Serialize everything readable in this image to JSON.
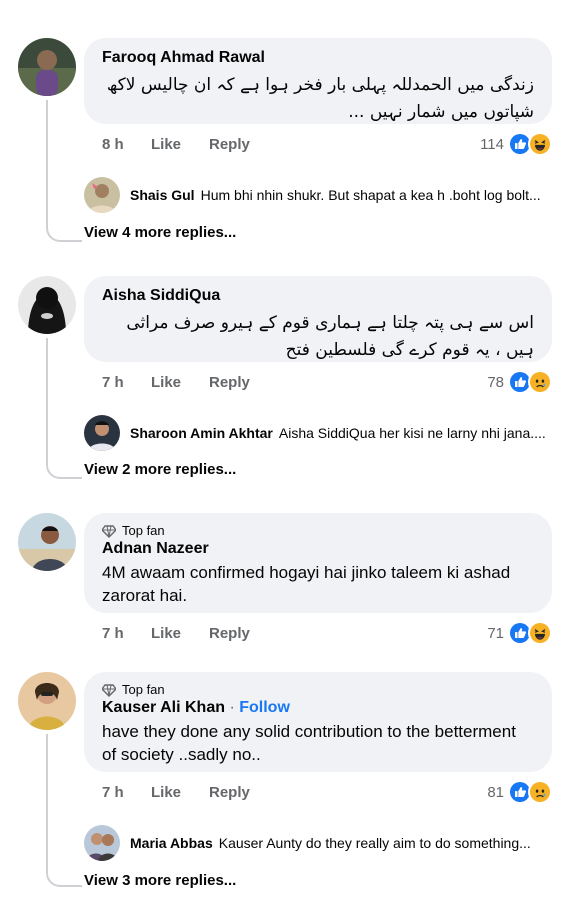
{
  "comments": [
    {
      "author": "Farooq Ahmad Rawal",
      "text": "زندگی میں الحمدللہ پہلی بار فخر ہوا ہے کہ ان چالیس لاکھ شپاتوں میں شمار نہیں ...",
      "time": "8 h",
      "like": "Like",
      "reply": "Reply",
      "reaction_count": "114",
      "reactions": [
        "like-reaction",
        "haha-reaction"
      ],
      "top_reply": {
        "author": "Shais Gul",
        "text": "Hum bhi nhin shukr. But shapat a kea h .boht log bolt..."
      },
      "more_replies": "View 4 more replies..."
    },
    {
      "author": "Aisha SiddiQua",
      "text": "اس سے ہی پتہ چلتا ہے ہماری قوم کے ہیرو صرف  مراثی ہیں ، یہ قوم کرے گی فلسطین فتح",
      "time": "7 h",
      "like": "Like",
      "reply": "Reply",
      "reaction_count": "78",
      "reactions": [
        "like-reaction",
        "sad-reaction"
      ],
      "top_reply": {
        "author": "Sharoon Amin Akhtar",
        "text": "Aisha SiddiQua her kisi ne larny nhi jana...."
      },
      "more_replies": "View 2 more replies..."
    },
    {
      "badge": "Top fan",
      "author": "Adnan Nazeer",
      "text": "4M awaam confirmed hogayi hai jinko taleem ki ashad zarorat hai.",
      "time": "7 h",
      "like": "Like",
      "reply": "Reply",
      "reaction_count": "71",
      "reactions": [
        "like-reaction",
        "haha-reaction"
      ]
    },
    {
      "badge": "Top fan",
      "author": "Kauser Ali Khan",
      "separator": "·",
      "follow": "Follow",
      "text": "have they done any solid contribution to the betterment of society ..sadly no..",
      "time": "7 h",
      "like": "Like",
      "reply": "Reply",
      "reaction_count": "81",
      "reactions": [
        "like-reaction",
        "sad-reaction"
      ],
      "top_reply": {
        "author": "Maria Abbas",
        "text": "Kauser Aunty do they really aim to do something..."
      },
      "more_replies": "View 3 more replies..."
    }
  ],
  "colors": {
    "bubble": "#f0f2f5",
    "muted": "#65676b",
    "link": "#1877f2",
    "thread": "#ced0d4"
  }
}
